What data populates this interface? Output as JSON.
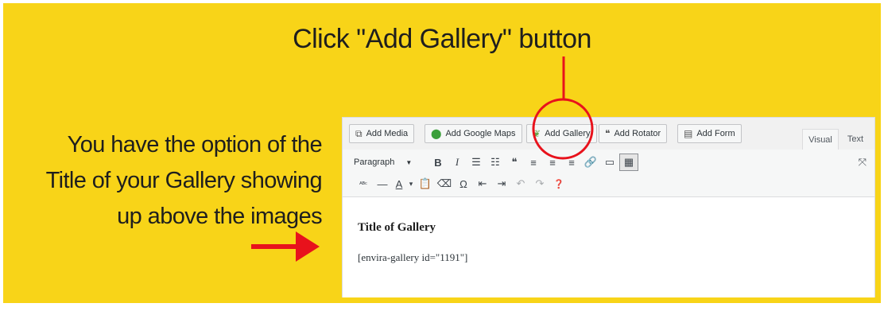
{
  "headline": "Click \"Add Gallery\" button",
  "description": {
    "lines": [
      "You have the option of the",
      "Title of your Gallery showing",
      "up above the images"
    ]
  },
  "editor": {
    "media_buttons": [
      {
        "label": "Add Media",
        "icon": "media-icon"
      },
      {
        "label": "Add Google Maps",
        "icon": "map-pin-icon"
      },
      {
        "label": "Add Gallery",
        "icon": "gallery-leaf-icon"
      },
      {
        "label": "Add Rotator",
        "icon": "quote-icon"
      },
      {
        "label": "Add Form",
        "icon": "form-icon"
      }
    ],
    "tabs": [
      {
        "label": "Visual",
        "active": true
      },
      {
        "label": "Text",
        "active": false
      }
    ],
    "format_select": "Paragraph",
    "toolbar_row1": [
      "B",
      "I",
      "☰",
      "☷",
      "❝",
      "≡",
      "≡",
      "≡",
      "🔗",
      "▭",
      "▦"
    ],
    "toolbar_row2": [
      "ᴬᴮᶜ",
      "—",
      "A",
      "▾",
      "📋",
      "⌫",
      "Ω",
      "⇤",
      "⇥",
      "↶",
      "↷",
      "❓"
    ],
    "content": {
      "title": "Title of Gallery",
      "shortcode": "[envira-gallery id=\"1191\"]"
    }
  },
  "colors": {
    "background": "#f8d418",
    "annotation_red": "#e8121c",
    "text_dark": "#1e1e1e",
    "maps_pin_green": "#3a9f3a",
    "gallery_icon_green": "#6aa84f"
  }
}
